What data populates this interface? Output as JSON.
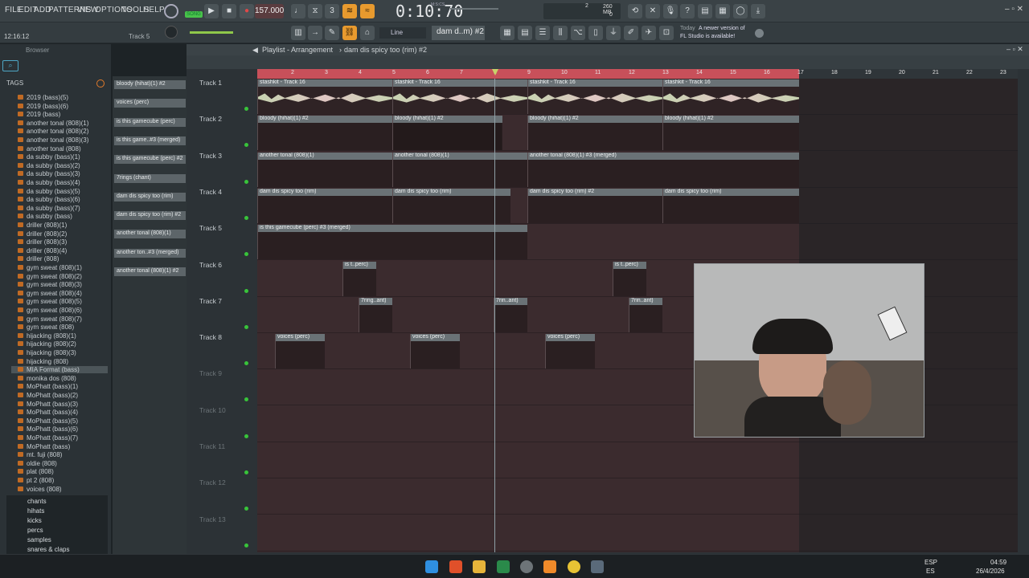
{
  "menu": [
    "FILE",
    "EDIT",
    "ADD",
    "PATTERNS",
    "VIEW",
    "OPTIONS",
    "TOOLS",
    "HELP"
  ],
  "transport": {
    "mode": "SONG",
    "tempo": "157.000",
    "time": "0:10:70",
    "time_unit": "M:S:CS",
    "cpu_label": "260 MB",
    "cpu_val": "0",
    "voices": "2"
  },
  "hint": {
    "time": "12:16:12",
    "track": "Track 5"
  },
  "toolbar2": {
    "snap": "Line",
    "pattern": "dam d..m) #2"
  },
  "news": {
    "label": "Today",
    "text1": "A newer version of",
    "text2": "FL Studio is available!"
  },
  "browser": {
    "title": "Browser",
    "tags": "TAGS",
    "items": [
      "2019 (bass)(5)",
      "2019 (bass)(6)",
      "2019 (bass)",
      "another tonal (808)(1)",
      "another tonal (808)(2)",
      "another tonal (808)(3)",
      "another tonal (808)",
      "da subby (bass)(1)",
      "da subby (bass)(2)",
      "da subby (bass)(3)",
      "da subby (bass)(4)",
      "da subby (bass)(5)",
      "da subby (bass)(6)",
      "da subby (bass)(7)",
      "da subby (bass)",
      "driller (808)(1)",
      "driller (808)(2)",
      "driller (808)(3)",
      "driller (808)(4)",
      "driller (808)",
      "gym sweat (808)(1)",
      "gym sweat (808)(2)",
      "gym sweat (808)(3)",
      "gym sweat (808)(4)",
      "gym sweat (808)(5)",
      "gym sweat (808)(6)",
      "gym sweat (808)(7)",
      "gym sweat (808)",
      "hijacking (808)(1)",
      "hijacking (808)(2)",
      "hijacking (808)(3)",
      "hijacking (808)",
      "MIA Format (bass)",
      "monika dos (808)",
      "MoPhatt (bass)(1)",
      "MoPhatt (bass)(2)",
      "MoPhatt (bass)(3)",
      "MoPhatt (bass)(4)",
      "MoPhatt (bass)(5)",
      "MoPhatt (bass)(6)",
      "MoPhatt (bass)(7)",
      "MoPhatt (bass)",
      "mt. fuji (808)",
      "oldie (808)",
      "plat (808)",
      "pt 2 (808)",
      "voices (808)"
    ],
    "categories": [
      "chants",
      "hihats",
      "kicks",
      "percs",
      "samples",
      "snares & claps"
    ]
  },
  "patterns": [
    "bloody (hihat)(1) #2",
    "voices (perc)",
    "is this gamecube (perc)",
    "is this game..#3 (merged)",
    "is this gamecube (perc) #2",
    "7rings (chant)",
    "dam dis spicy too (rim)",
    "dam dis spicy too (rim) #2",
    "another tonal (808)(1)",
    "another ton..#3 (merged)",
    "another tonal (808)(1) #2"
  ],
  "playlist": {
    "title": "Playlist - Arrangement",
    "pattern": "dam dis spicy too (rim) #2"
  },
  "tracks": [
    "Track 1",
    "Track 2",
    "Track 3",
    "Track 4",
    "Track 5",
    "Track 6",
    "Track 7",
    "Track 8",
    "Track 9",
    "Track 10",
    "Track 11",
    "Track 12",
    "Track 13"
  ],
  "ruler": [
    "2",
    "3",
    "4",
    "5",
    "6",
    "7",
    "8",
    "9",
    "10",
    "11",
    "12",
    "13",
    "14",
    "15",
    "16",
    "17",
    "18",
    "19",
    "20",
    "21",
    "22",
    "23"
  ],
  "clips": {
    "t1": [
      "stashkit - Track 16",
      "stashkit - Track 16",
      "stashkit - Track 16",
      "stashkit - Track 16"
    ],
    "t2": [
      "bloody (hihat)(1) #2",
      "bloody (hihat)(1) #2",
      "bloody (hihat)(1) #2",
      "bloody (hihat)(1) #2"
    ],
    "t3": [
      "another tonal (808)(1)",
      "another tonal (808)(1)",
      "another tonal (808)(1) #3 (merged)"
    ],
    "t4": [
      "dam dis spicy too (rim)",
      "dam dis spicy too (rim)",
      "dam dis spicy too (rim) #2",
      "dam dis spicy too (rim)"
    ],
    "t5": [
      "is this gamecube (perc) #3 (merged)"
    ],
    "t6": [
      "is t..perc)",
      "is t..perc)"
    ],
    "t7": [
      "7ring..ant)",
      "7rin..ant)",
      "7rin..ant)"
    ],
    "t8": [
      "voices (perc)",
      "voices (perc)",
      "voices (perc)"
    ]
  },
  "taskbar": {
    "lang1": "ESP",
    "lang2": "ES",
    "time": "04:59",
    "date": "26/4/2026"
  }
}
